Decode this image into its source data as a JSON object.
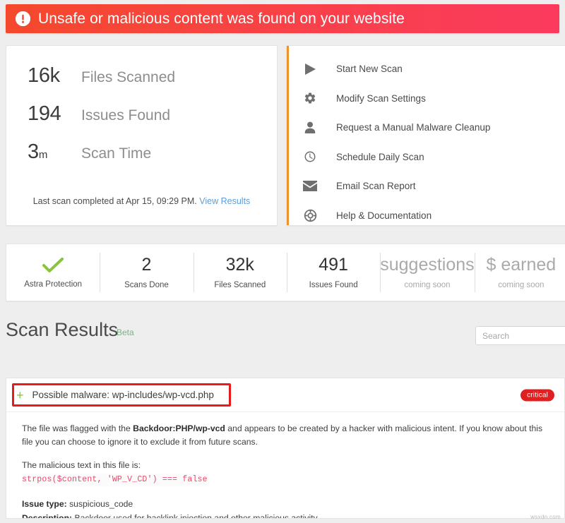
{
  "alert": {
    "icon": "exclamation-circle-icon",
    "message": "Unsafe or malicious content was found on your website",
    "gradient_from": "#f4492c",
    "gradient_to": "#fb3a5e"
  },
  "summary": {
    "stats": [
      {
        "value": "16k",
        "unit": "",
        "label": "Files Scanned"
      },
      {
        "value": "194",
        "unit": "",
        "label": "Issues Found"
      },
      {
        "value": "3",
        "unit": "m",
        "label": "Scan Time"
      }
    ],
    "footer_text": "Last scan completed at Apr 15, 09:29 PM.",
    "footer_link": "View Results"
  },
  "actions": {
    "rail_top_color": "#4a90d9",
    "rail_bottom_color": "#f0922b",
    "items": [
      {
        "icon": "play-icon",
        "label": "Start New Scan"
      },
      {
        "icon": "gear-icon",
        "label": "Modify Scan Settings"
      },
      {
        "icon": "person-icon",
        "label": "Request a Manual Malware Cleanup"
      },
      {
        "icon": "clock-icon",
        "label": "Schedule Daily Scan"
      },
      {
        "icon": "envelope-icon",
        "label": "Email Scan Report"
      },
      {
        "icon": "lifebuoy-icon",
        "label": "Help & Documentation"
      }
    ]
  },
  "stats_strip": {
    "cells": [
      {
        "icon": "green-check-icon",
        "value": "",
        "label": "Astra Protection",
        "muted": false
      },
      {
        "icon": "",
        "value": "2",
        "label": "Scans Done",
        "muted": false
      },
      {
        "icon": "",
        "value": "32k",
        "label": "Files Scanned",
        "muted": false
      },
      {
        "icon": "",
        "value": "491",
        "label": "Issues Found",
        "muted": false
      },
      {
        "icon": "",
        "value": "suggestions",
        "label": "coming soon",
        "muted": true
      },
      {
        "icon": "",
        "value": "$ earned",
        "label": "coming soon",
        "muted": true
      }
    ],
    "check_color": "#8ac43f"
  },
  "results": {
    "title": "Scan Results",
    "beta_badge": "Beta",
    "search_placeholder": "Search",
    "search_value": "",
    "issue": {
      "expander": "+",
      "title": "Possible malware: wp-includes/wp-vcd.php",
      "severity": "critical",
      "severity_color": "#e02020",
      "description_part1": "The file was flagged with the ",
      "description_bold": "Backdoor:PHP/wp-vcd",
      "description_part2": " and appears to be created by a hacker with malicious intent. If you know about this file you can choose to ignore it to exclude it from future scans.",
      "malicious_intro": "The malicious text in this file is:",
      "malicious_code": "strpos($content, 'WP_V_CD') === false",
      "issue_type_label": "Issue type:",
      "issue_type_value": "suspicious_code",
      "description_label": "Description:",
      "description_value": "Backdoor used for backlink injection and other malicious activity."
    }
  },
  "watermark": "wsxdn.com"
}
